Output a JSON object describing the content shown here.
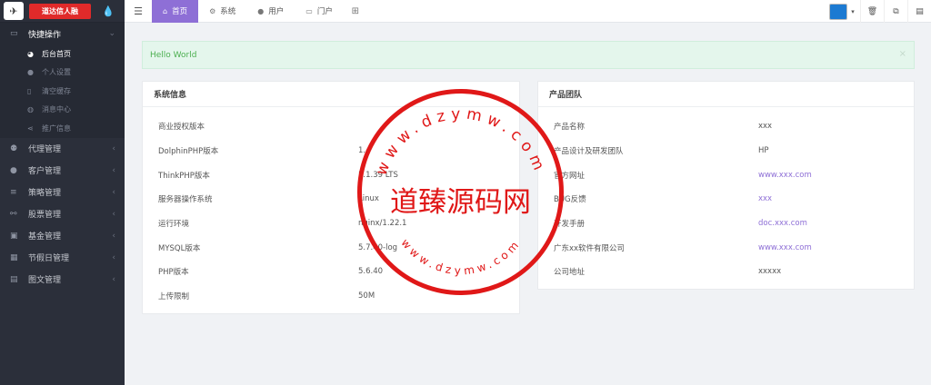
{
  "brand": {
    "name": "道达信人融"
  },
  "sidebar": {
    "groups": [
      {
        "label": "快捷操作",
        "icon": "folder-open-icon",
        "open": true,
        "items": [
          {
            "label": "后台首页",
            "icon": "dashboard-icon",
            "active": true
          },
          {
            "label": "个人设置",
            "icon": "user-icon",
            "active": false
          },
          {
            "label": "清空缓存",
            "icon": "trash-icon",
            "active": false
          },
          {
            "label": "消息中心",
            "icon": "message-icon",
            "active": false
          },
          {
            "label": "推广信息",
            "icon": "share-icon",
            "active": false
          }
        ]
      },
      {
        "label": "代理管理",
        "icon": "users-icon"
      },
      {
        "label": "客户管理",
        "icon": "user-icon"
      },
      {
        "label": "策略管理",
        "icon": "list-icon"
      },
      {
        "label": "股票管理",
        "icon": "chart-icon"
      },
      {
        "label": "基金管理",
        "icon": "wallet-icon"
      },
      {
        "label": "节假日管理",
        "icon": "calendar-icon"
      },
      {
        "label": "图文管理",
        "icon": "image-icon"
      }
    ]
  },
  "topnav": {
    "items": [
      {
        "label": "首页",
        "icon": "home-icon",
        "active": true
      },
      {
        "label": "系统",
        "icon": "gear-icon",
        "active": false
      },
      {
        "label": "用户",
        "icon": "user-icon",
        "active": false
      },
      {
        "label": "门户",
        "icon": "portal-icon",
        "active": false
      }
    ]
  },
  "alert": {
    "text": "Hello World",
    "close": "×"
  },
  "system_panel": {
    "title": "系统信息",
    "rows": [
      {
        "key": "商业授权版本",
        "value": ""
      },
      {
        "key": "DolphinPHP版本",
        "value": "1.4"
      },
      {
        "key": "ThinkPHP版本",
        "value": "5.1.39 LTS"
      },
      {
        "key": "服务器操作系统",
        "value": "Linux"
      },
      {
        "key": "运行环境",
        "value": "nginx/1.22.1"
      },
      {
        "key": "MYSQL版本",
        "value": "5.7.40-log"
      },
      {
        "key": "PHP版本",
        "value": "5.6.40"
      },
      {
        "key": "上传限制",
        "value": "50M"
      }
    ]
  },
  "team_panel": {
    "title": "产品团队",
    "rows": [
      {
        "key": "产品名称",
        "value": "xxx",
        "link": false
      },
      {
        "key": "产品设计及研发团队",
        "value": "HP",
        "link": false
      },
      {
        "key": "官方网址",
        "value": "www.xxx.com",
        "link": true
      },
      {
        "key": "BUG反馈",
        "value": "xxx",
        "link": true
      },
      {
        "key": "开发手册",
        "value": "doc.xxx.com",
        "link": true
      },
      {
        "key": "广东xx软件有限公司",
        "value": "www.xxx.com",
        "link": true
      },
      {
        "key": "公司地址",
        "value": "xxxxx",
        "link": false
      }
    ]
  },
  "stamp": {
    "center": "道臻源码网",
    "top_arc": "www.dzymw.com",
    "bottom_arc": "www.dzymw.com"
  },
  "colors": {
    "accent": "#8e6fd6",
    "sidebar": "#2b2f3a",
    "alert_bg": "#e4f6ec",
    "alert_text": "#4caf50",
    "stamp": "#e01818"
  }
}
